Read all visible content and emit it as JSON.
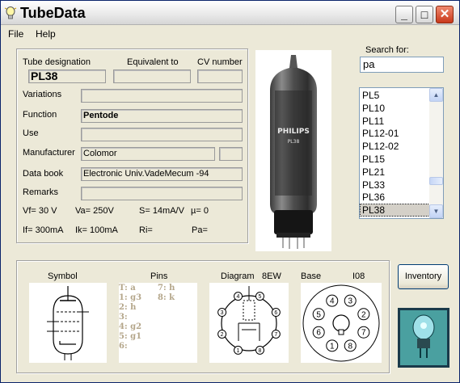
{
  "window": {
    "title": "TubeData"
  },
  "titlebar": {
    "minimize": "_",
    "maximize": "□",
    "close": "✕"
  },
  "menu": {
    "file": "File",
    "help": "Help"
  },
  "form": {
    "tube_designation_label": "Tube designation",
    "equivalent_label": "Equivalent to",
    "cv_label": "CV number",
    "tube_designation": "PL38",
    "equivalent": "",
    "cv_number": "",
    "variations_label": "Variations",
    "variations": "",
    "function_label": "Function",
    "function": "Pentode",
    "use_label": "Use",
    "use": "",
    "manufacturer_label": "Manufacturer",
    "manufacturer": "Colomor",
    "manufacturer_extra": "",
    "databook_label": "Data book",
    "databook": "Electronic Univ.VadeMecum -94",
    "remarks_label": "Remarks",
    "remarks": "",
    "vf": "Vf= 30 V",
    "va": "Va= 250V",
    "s": "S= 14mA/V",
    "mu": "µ=   0",
    "if": "If= 300mA",
    "ik": "Ik=  100mA",
    "ri": "Ri=",
    "pa": "Pa="
  },
  "search": {
    "label": "Search for:",
    "value": "pa",
    "results": [
      "PL5",
      "PL10",
      "PL11",
      "PL12-01",
      "PL12-02",
      "PL15",
      "PL21",
      "PL33",
      "PL36",
      "PL38"
    ],
    "selected": "PL38"
  },
  "bottom": {
    "symbol_label": "Symbol",
    "pins_label": "Pins",
    "diagram_label": "Diagram",
    "diagram_code": "8EW",
    "base_label": "Base",
    "base_code": "I08",
    "pins_col1": [
      "T: a",
      "1: g3",
      "2: h",
      "3:",
      "4: g2",
      "5: g1",
      "6:"
    ],
    "pins_col2": [
      "7: h",
      "8: k",
      "",
      "",
      "",
      "",
      ""
    ],
    "diagram_pins": [
      "4",
      "3",
      "5",
      "2",
      "6",
      "7",
      "1",
      "8"
    ],
    "base_pins": [
      "4",
      "5",
      "3",
      "6",
      "2",
      "7",
      "1",
      "8"
    ]
  },
  "buttons": {
    "inventory": "Inventory"
  },
  "photo": {
    "brand": "PHILIPS",
    "type": "PL38"
  }
}
